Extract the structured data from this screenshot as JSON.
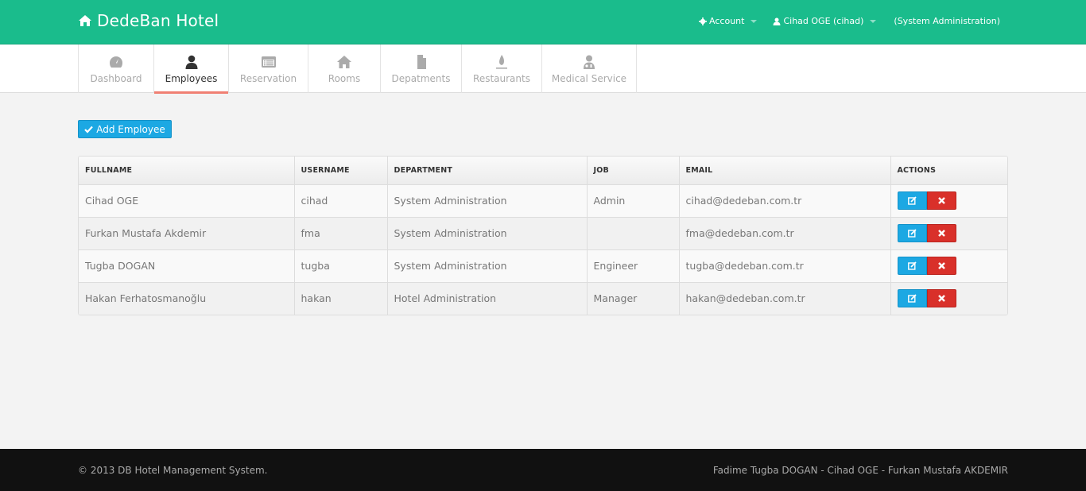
{
  "header": {
    "brand": "DedeBan Hotel",
    "brand_icon": "home-icon",
    "nav": {
      "account_label": "Account",
      "user_label": "Cihad OGE (cihad)",
      "role_label": "(System Administration)"
    }
  },
  "tabs": [
    {
      "label": "Dashboard",
      "icon": "dashboard-icon",
      "active": false
    },
    {
      "label": "Employees",
      "icon": "user-icon",
      "active": true
    },
    {
      "label": "Reservation",
      "icon": "list-alt-icon",
      "active": false
    },
    {
      "label": "Rooms",
      "icon": "home-icon",
      "active": false
    },
    {
      "label": "Depatments",
      "icon": "file-icon",
      "active": false
    },
    {
      "label": "Restaurants",
      "icon": "fire-icon",
      "active": false
    },
    {
      "label": "Medical Service",
      "icon": "doctor-icon",
      "active": false
    }
  ],
  "main": {
    "add_button_label": "Add Employee",
    "table": {
      "columns": [
        "FULLNAME",
        "USERNAME",
        "DEPARTMENT",
        "JOB",
        "EMAIL",
        "ACTIONS"
      ],
      "rows": [
        {
          "fullname": "Cihad OGE",
          "username": "cihad",
          "department": "System Administration",
          "job": "Admin",
          "email": "cihad@dedeban.com.tr"
        },
        {
          "fullname": "Furkan Mustafa Akdemir",
          "username": "fma",
          "department": "System Administration",
          "job": "",
          "email": "fma@dedeban.com.tr"
        },
        {
          "fullname": "Tugba DOGAN",
          "username": "tugba",
          "department": "System Administration",
          "job": "Engineer",
          "email": "tugba@dedeban.com.tr"
        },
        {
          "fullname": "Hakan Ferhatosmanoğlu",
          "username": "hakan",
          "department": "Hotel Administration",
          "job": "Manager",
          "email": "hakan@dedeban.com.tr"
        }
      ]
    }
  },
  "footer": {
    "copyright": "© 2013 DB Hotel Management System.",
    "authors": "Fadime Tugba DOGAN - Cihad OGE - Furkan Mustafa AKDEMIR"
  },
  "colors": {
    "brand": "#1abc8c",
    "active_tab_underline": "#f07f72",
    "primary_button": "#1ca8e3",
    "danger_button": "#d9302a",
    "footer_bg": "#111111"
  }
}
